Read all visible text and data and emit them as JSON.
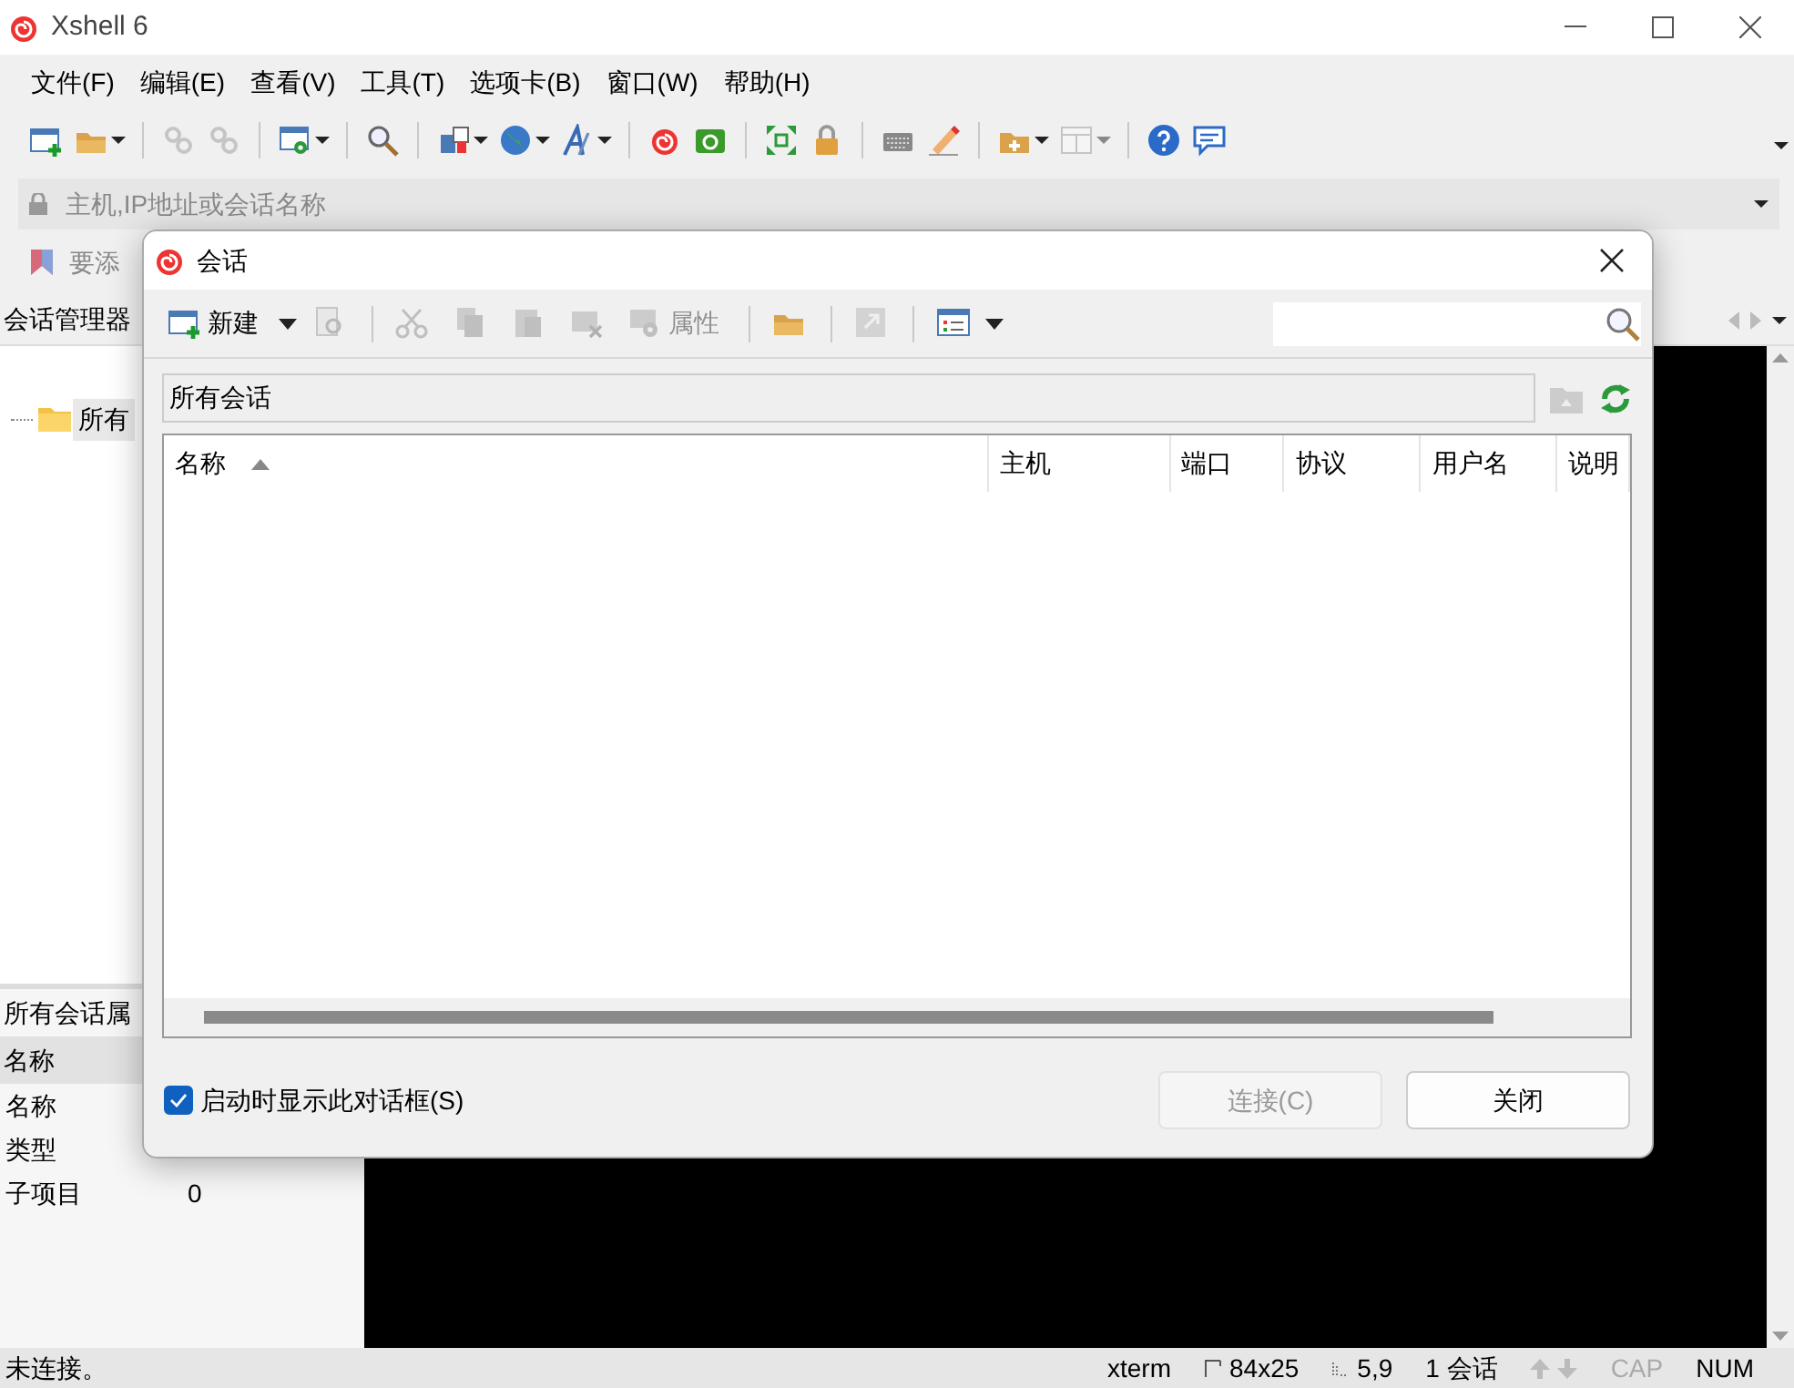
{
  "window": {
    "title": "Xshell 6"
  },
  "menu": [
    "文件(F)",
    "编辑(E)",
    "查看(V)",
    "工具(T)",
    "选项卡(B)",
    "窗口(W)",
    "帮助(H)"
  ],
  "toolbar": [
    {
      "kind": "new-window",
      "dropdown": false,
      "disabled": false
    },
    {
      "kind": "folder",
      "dropdown": true,
      "disabled": false
    },
    {
      "kind": "separator"
    },
    {
      "kind": "link",
      "dropdown": false,
      "disabled": true
    },
    {
      "kind": "link",
      "dropdown": false,
      "disabled": true
    },
    {
      "kind": "separator"
    },
    {
      "kind": "window-gear",
      "dropdown": true,
      "disabled": false
    },
    {
      "kind": "separator"
    },
    {
      "kind": "search",
      "dropdown": false,
      "disabled": false
    },
    {
      "kind": "separator"
    },
    {
      "kind": "transfer",
      "dropdown": true,
      "disabled": false
    },
    {
      "kind": "globe",
      "dropdown": true,
      "disabled": false
    },
    {
      "kind": "font",
      "dropdown": true,
      "disabled": false
    },
    {
      "kind": "separator"
    },
    {
      "kind": "spiral",
      "dropdown": false,
      "disabled": false
    },
    {
      "kind": "green-box",
      "dropdown": false,
      "disabled": false
    },
    {
      "kind": "separator"
    },
    {
      "kind": "expand",
      "dropdown": false,
      "disabled": false
    },
    {
      "kind": "lock",
      "dropdown": false,
      "disabled": false
    },
    {
      "kind": "separator"
    },
    {
      "kind": "keyboard",
      "dropdown": false,
      "disabled": false
    },
    {
      "kind": "pen",
      "dropdown": false,
      "disabled": false
    },
    {
      "kind": "separator"
    },
    {
      "kind": "folder-plus",
      "dropdown": true,
      "disabled": false
    },
    {
      "kind": "layout",
      "dropdown": true,
      "disabled": true
    },
    {
      "kind": "separator"
    },
    {
      "kind": "help",
      "dropdown": false,
      "disabled": false
    },
    {
      "kind": "chat",
      "dropdown": false,
      "disabled": false
    }
  ],
  "address_bar": {
    "placeholder": "主机,IP地址或会话名称"
  },
  "links_bar": {
    "text": "要添"
  },
  "session_manager": {
    "title": "会话管理器",
    "tree": [
      {
        "label": "所有",
        "selected": true
      }
    ]
  },
  "properties": {
    "title": "所有会话属",
    "header": "名称",
    "rows": [
      {
        "name": "名称"
      },
      {
        "name": "类型"
      },
      {
        "name": "子项目",
        "value": "0"
      }
    ]
  },
  "status_bar": {
    "message": "未连接。",
    "terminal": "xterm",
    "size": "84x25",
    "cursor": "5,9",
    "sessions": "1 会话",
    "caps": {
      "label": "CAP",
      "on": false
    },
    "num": {
      "label": "NUM",
      "on": true
    }
  },
  "dialog": {
    "title": "会话",
    "toolbar": [
      {
        "kind": "new-window",
        "label": "新建",
        "dropdown": true,
        "disabled": false
      },
      {
        "kind": "find",
        "dropdown": false,
        "disabled": true
      },
      {
        "kind": "separator"
      },
      {
        "kind": "cut",
        "dropdown": false,
        "disabled": true
      },
      {
        "kind": "copy",
        "dropdown": false,
        "disabled": true
      },
      {
        "kind": "paste",
        "dropdown": false,
        "disabled": true
      },
      {
        "kind": "delete",
        "dropdown": false,
        "disabled": true
      },
      {
        "kind": "gear",
        "label": "属性",
        "dropdown": false,
        "disabled": true
      },
      {
        "kind": "separator"
      },
      {
        "kind": "folder",
        "dropdown": false,
        "disabled": false
      },
      {
        "kind": "separator"
      },
      {
        "kind": "export",
        "dropdown": false,
        "disabled": true
      },
      {
        "kind": "separator"
      },
      {
        "kind": "list-view",
        "dropdown": true,
        "disabled": false
      }
    ],
    "path": "所有会话",
    "columns": [
      {
        "label": "名称",
        "sorted": true
      },
      {
        "label": "主机",
        "sorted": false
      },
      {
        "label": "端口",
        "sorted": false
      },
      {
        "label": "协议",
        "sorted": false
      },
      {
        "label": "用户名",
        "sorted": false
      },
      {
        "label": "说明",
        "sorted": false
      }
    ],
    "show_on_startup": {
      "label": "启动时显示此对话框(S)",
      "checked": true
    },
    "buttons": [
      {
        "label": "连接(C)",
        "disabled": true
      },
      {
        "label": "关闭",
        "disabled": false
      }
    ]
  }
}
